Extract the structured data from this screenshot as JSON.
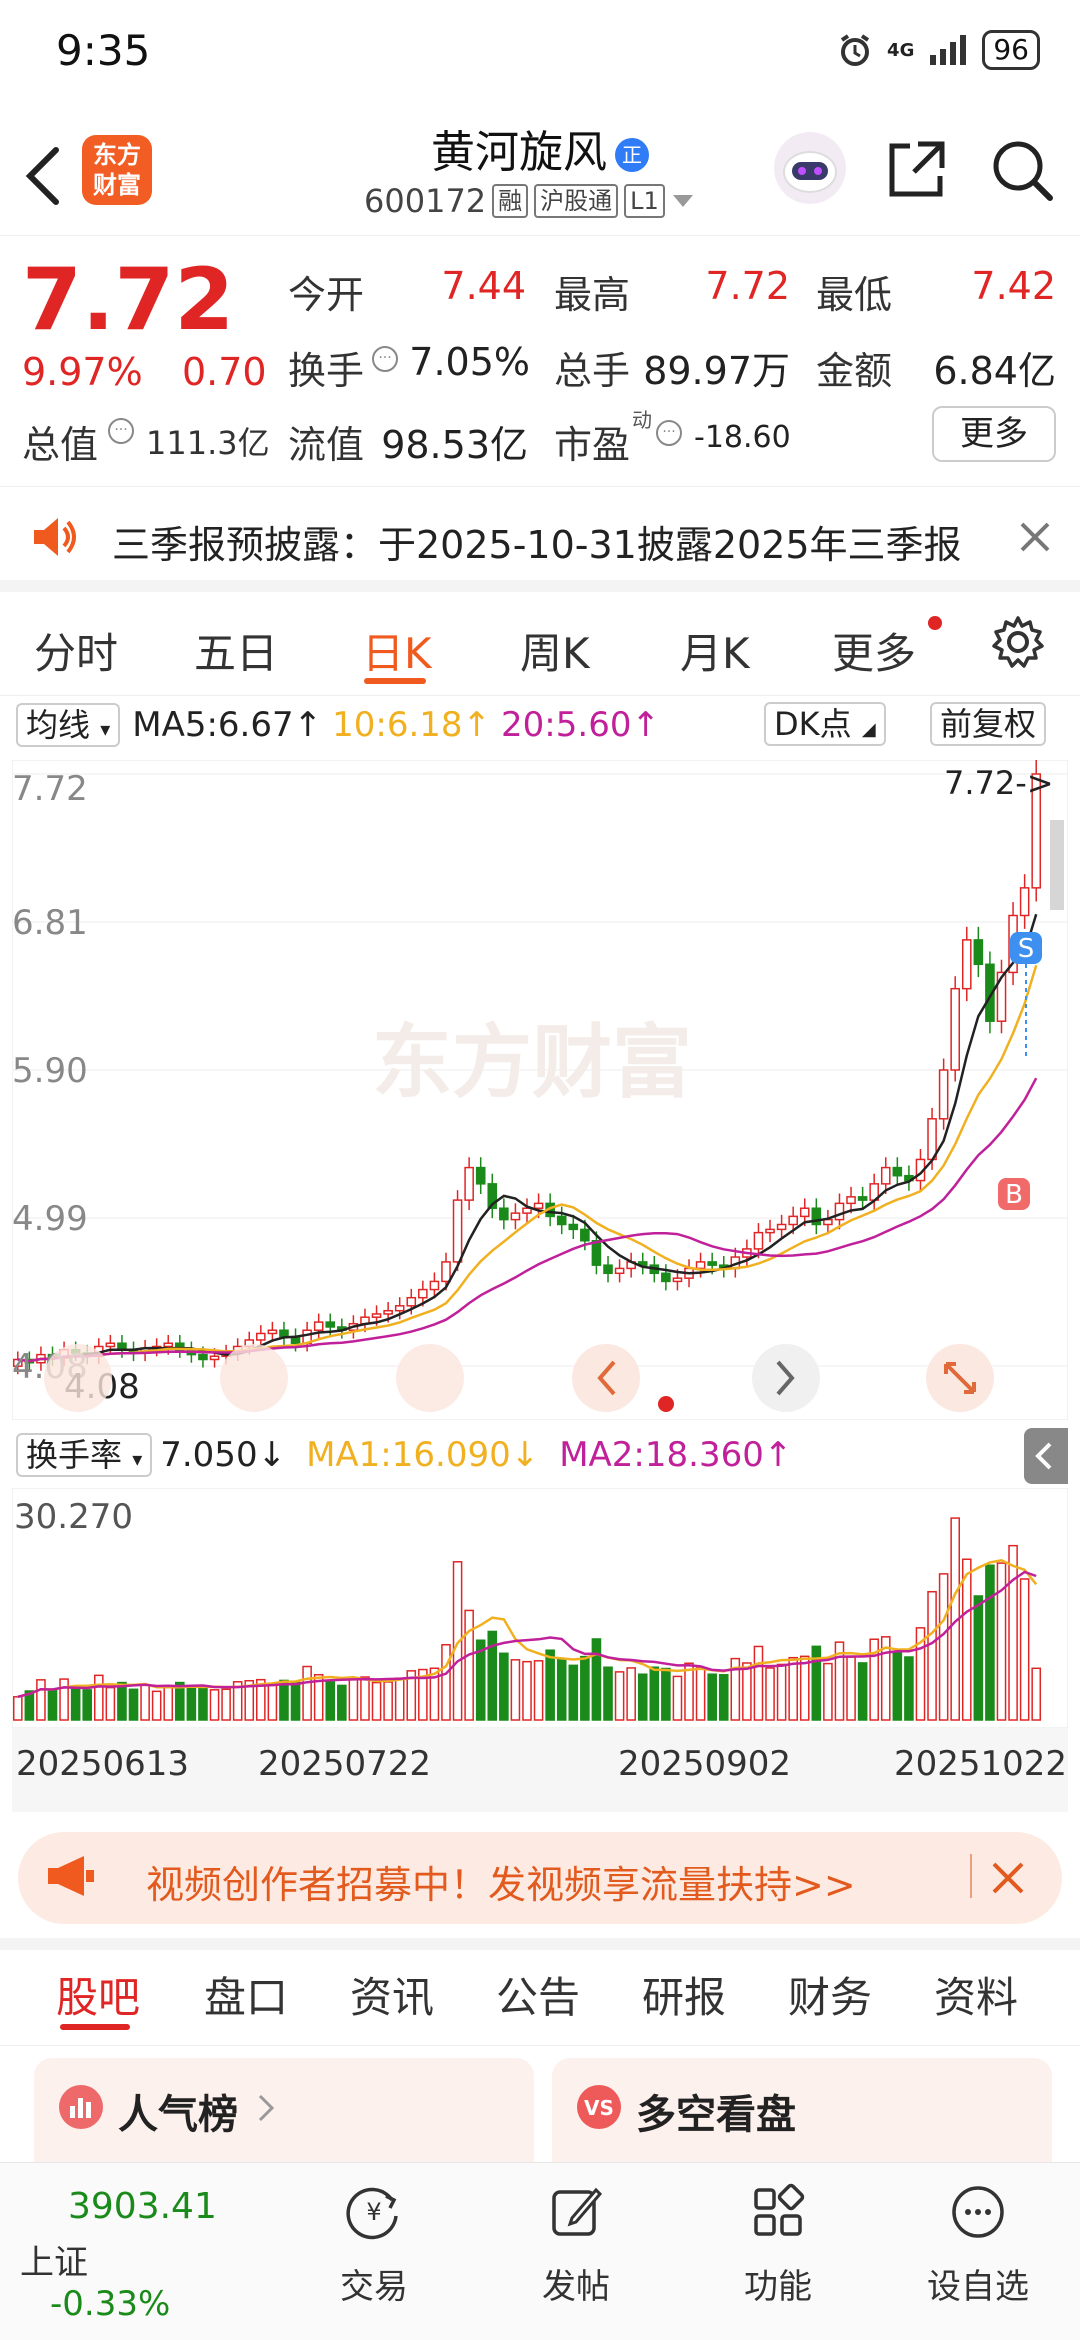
{
  "status_bar": {
    "time": "9:35",
    "battery": "96",
    "network": "4G"
  },
  "header": {
    "logo_text": "东方财富",
    "stock_name": "黄河旋风",
    "badge": "正",
    "stock_code": "600172",
    "tags": [
      "融",
      "沪股通",
      "L1"
    ]
  },
  "quote": {
    "price": "7.72",
    "change_pct": "9.97%",
    "change": "0.70",
    "open_label": "今开",
    "open": "7.44",
    "high_label": "最高",
    "high": "7.72",
    "low_label": "最低",
    "low": "7.42",
    "turnover_label": "换手",
    "turnover": "7.05%",
    "volume_label": "总手",
    "volume": "89.97万",
    "amount_label": "金额",
    "amount": "6.84亿",
    "mktcap_label": "总值",
    "mktcap": "111.3亿",
    "float_label": "流值",
    "float": "98.53亿",
    "pe_label": "市盈",
    "pe_sup": "动",
    "pe": "-18.60",
    "more": "更多"
  },
  "notice": {
    "text": "三季报预披露：于2025-10-31披露2025年三季报"
  },
  "chart_tabs": [
    "分时",
    "五日",
    "日K",
    "周K",
    "月K",
    "更多"
  ],
  "ma_bar": {
    "selector": "均线",
    "ma5": "MA5:6.67↑",
    "ma10": "10:6.18↑",
    "ma20": "20:5.60↑",
    "dk": "DK点",
    "adjust": "前复权"
  },
  "kline": {
    "y_labels": [
      "7.72",
      "6.81",
      "5.90",
      "4.99",
      "4.08"
    ],
    "last_label": "7.72->",
    "low_label": "4.08",
    "watermark": "东方财富",
    "marker_s": "S",
    "marker_b": "B"
  },
  "volume_bar": {
    "selector": "换手率",
    "value": "7.050↓",
    "ma1": "MA1:16.090↓",
    "ma2": "MA2:18.360↑",
    "top_label": "30.270",
    "dates": [
      "20250613",
      "20250722",
      "20250902",
      "20251022"
    ]
  },
  "colors": {
    "up": "#e02525",
    "down": "#1a8b1a",
    "accent": "#f05a1e",
    "ma5": "#222222",
    "ma10": "#f0b020",
    "ma20": "#c0209a"
  },
  "promo": {
    "text": "视频创作者招募中！发视频享流量扶持>>"
  },
  "bottom_tabs": [
    "股吧",
    "盘口",
    "资讯",
    "公告",
    "研报",
    "财务",
    "资料"
  ],
  "cards": {
    "left": "人气榜",
    "right": "多空看盘"
  },
  "index": {
    "value": "3903.41",
    "name": "上证",
    "change": "-0.33%"
  },
  "nav": {
    "trade": "交易",
    "post": "发帖",
    "features": "功能",
    "watchlist": "设自选"
  },
  "chart_data": {
    "type": "candlestick",
    "title": "",
    "ylim": [
      4.08,
      7.72
    ],
    "x_ticks": [
      "20250613",
      "20250722",
      "20250902",
      "20251022"
    ],
    "closes": [
      4.12,
      4.1,
      4.15,
      4.13,
      4.18,
      4.16,
      4.14,
      4.2,
      4.22,
      4.18,
      4.16,
      4.19,
      4.2,
      4.22,
      4.18,
      4.15,
      4.12,
      4.14,
      4.16,
      4.2,
      4.24,
      4.28,
      4.3,
      4.26,
      4.22,
      4.3,
      4.35,
      4.32,
      4.3,
      4.34,
      4.38,
      4.4,
      4.42,
      4.45,
      4.5,
      4.55,
      4.6,
      4.72,
      5.1,
      5.3,
      5.2,
      5.05,
      4.98,
      5.02,
      5.05,
      5.08,
      5.0,
      4.95,
      4.92,
      4.85,
      4.7,
      4.65,
      4.68,
      4.72,
      4.7,
      4.65,
      4.6,
      4.62,
      4.68,
      4.72,
      4.7,
      4.68,
      4.75,
      4.8,
      4.9,
      4.92,
      4.95,
      5.0,
      5.05,
      4.95,
      4.98,
      5.08,
      5.12,
      5.1,
      5.2,
      5.3,
      5.25,
      5.22,
      5.35,
      5.6,
      5.9,
      6.4,
      6.7,
      6.55,
      6.2,
      6.5,
      6.85,
      7.02,
      7.72
    ],
    "ma5_last": 6.67,
    "ma10_last": 6.18,
    "ma20_last": 5.6,
    "turnover_last": 7.05,
    "turnover_max": 30.27
  }
}
